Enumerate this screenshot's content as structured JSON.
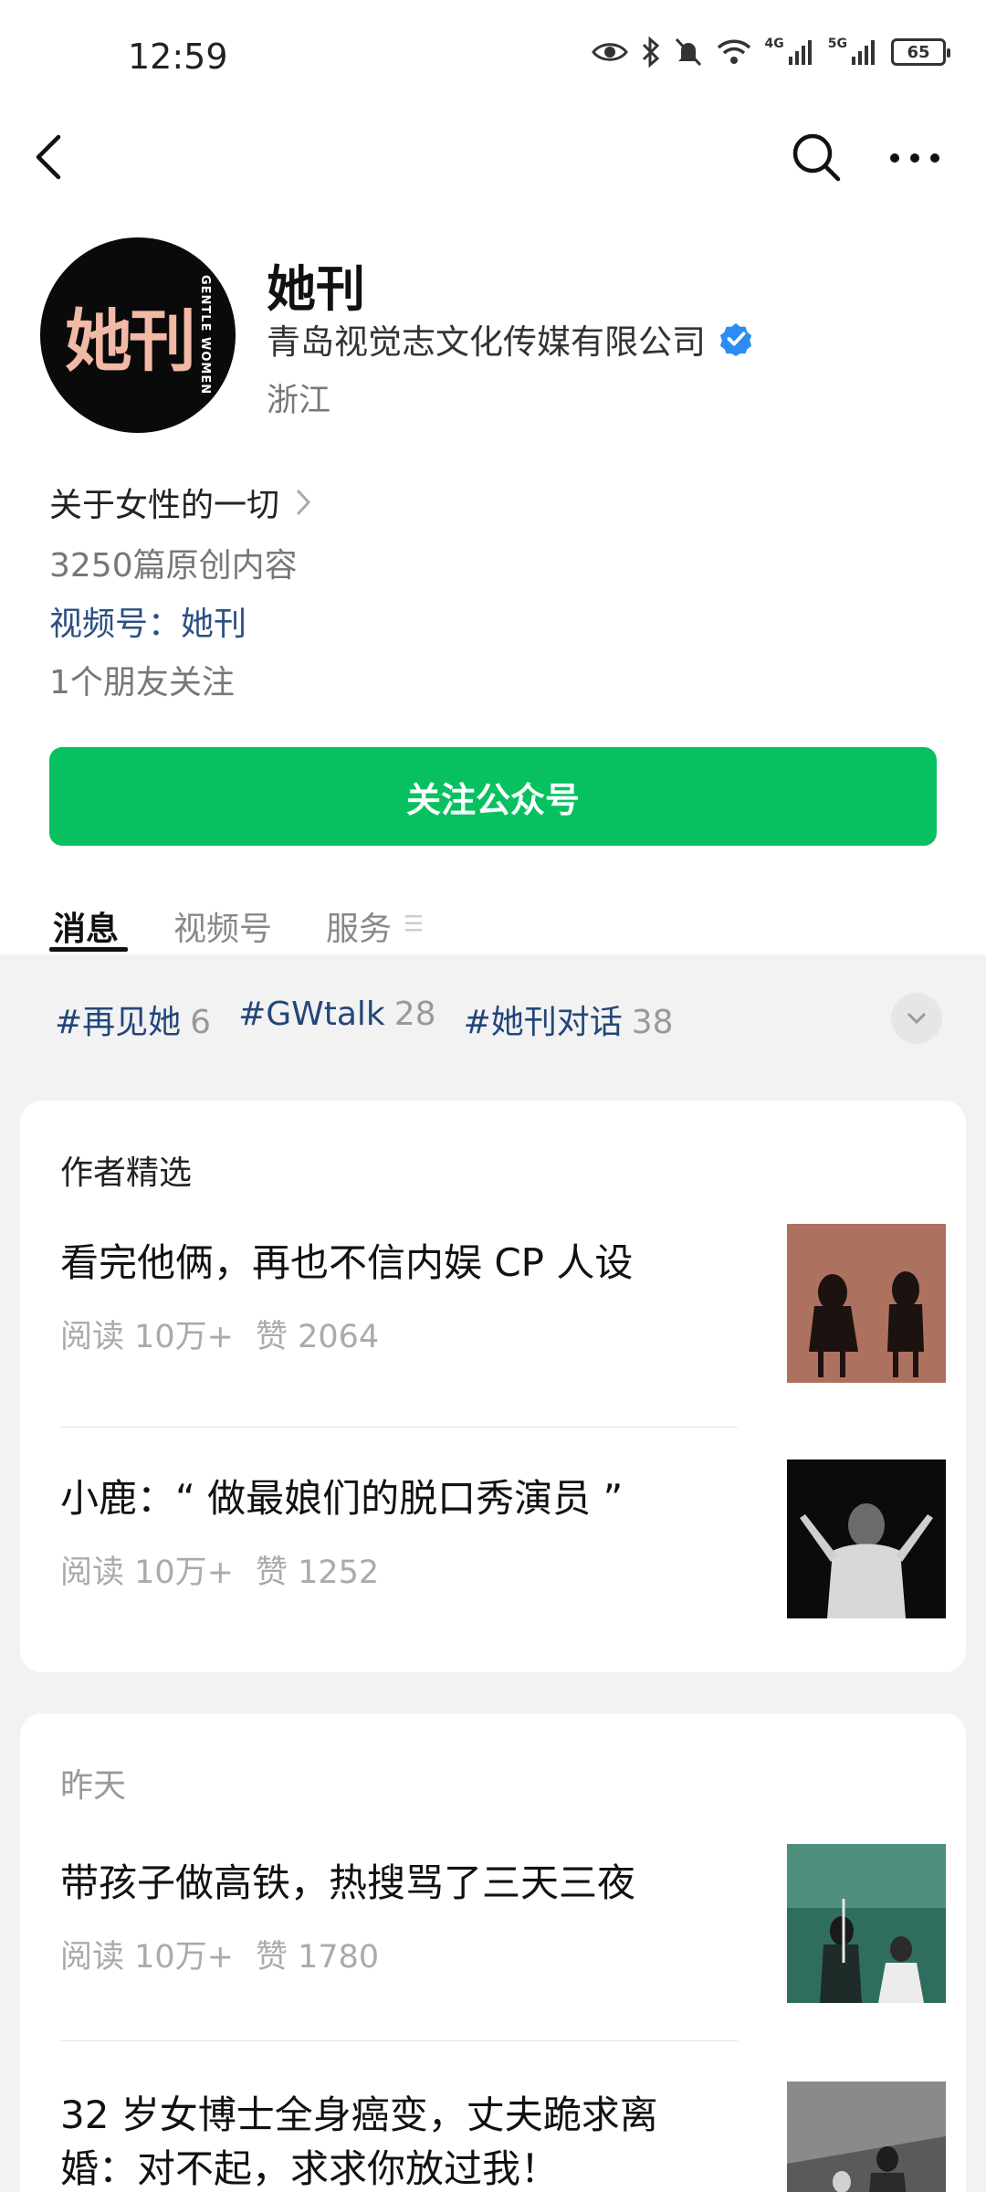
{
  "status_bar": {
    "time": "12:59",
    "battery": "65",
    "net1": "4G",
    "net2": "5G"
  },
  "account": {
    "name": "她刊",
    "avatar_text": "她刊",
    "avatar_sub": "GENTLE WOMEN",
    "company": "青岛视觉志文化传媒有限公司",
    "region": "浙江",
    "intro": "关于女性的一切",
    "originals": "3250篇原创内容",
    "channel": "视频号：她刊",
    "friends": "1个朋友关注",
    "follow_label": "关注公众号"
  },
  "tabs": [
    "消息",
    "视频号",
    "服务"
  ],
  "tags": [
    {
      "name": "#再见她",
      "count": "6"
    },
    {
      "name": "#GWtalk",
      "count": "28"
    },
    {
      "name": "#她刊对话",
      "count": "38"
    }
  ],
  "featured": {
    "title": "作者精选",
    "articles": [
      {
        "title": "看完他俩，再也不信内娱 CP 人设",
        "reads": "阅读 10万+",
        "likes": "赞 2064"
      },
      {
        "title": "小鹿：“ 做最娘们的脱口秀演员 ”",
        "reads": "阅读 10万+",
        "likes": "赞 1252"
      }
    ]
  },
  "yesterday": {
    "title": "昨天",
    "articles": [
      {
        "title": "带孩子做高铁，热搜骂了三天三夜",
        "reads": "阅读 10万+",
        "likes": "赞 1780"
      },
      {
        "title": "32 岁女博士全身癌变，丈夫跪求离婚：对不起，求求你放过我！"
      }
    ]
  },
  "colors": {
    "accent_green": "#07c160",
    "link_blue": "#2c4f83",
    "verified_blue": "#2b8cf3"
  }
}
